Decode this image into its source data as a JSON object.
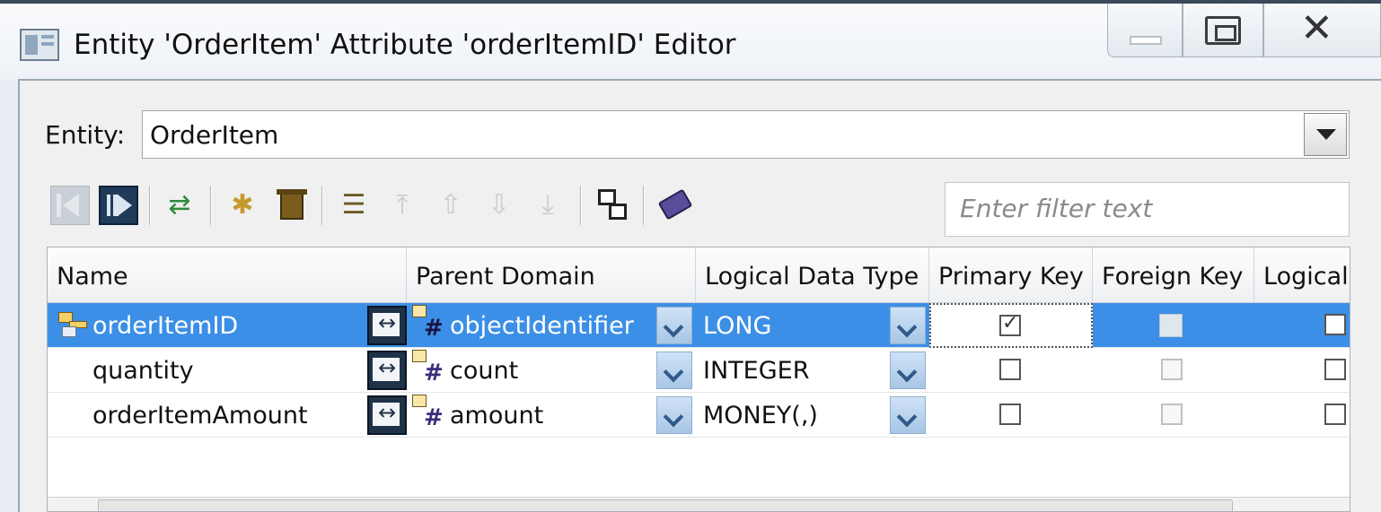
{
  "window": {
    "title": "Entity 'OrderItem' Attribute 'orderItemID' Editor"
  },
  "entity": {
    "label": "Entity:",
    "value": "OrderItem"
  },
  "filter": {
    "placeholder": "Enter filter text"
  },
  "toolbar": {
    "icons": [
      "first-icon",
      "last-icon",
      "generate-icon",
      "new-attribute-icon",
      "delete-icon",
      "properties-icon",
      "move-top-icon",
      "move-up-icon",
      "move-down-icon",
      "move-bottom-icon",
      "copy-icon",
      "tag-icon"
    ]
  },
  "grid": {
    "columns": [
      "Name",
      "Parent Domain",
      "Logical Data Type",
      "Primary Key",
      "Foreign Key",
      "Logical"
    ],
    "rows": [
      {
        "name": "orderItemID",
        "domain": "objectIdentifier",
        "type": "LONG",
        "primary_key": true,
        "foreign_key": false,
        "logical": false,
        "selected": true
      },
      {
        "name": "quantity",
        "domain": "count",
        "type": "INTEGER",
        "primary_key": false,
        "foreign_key": false,
        "logical": false,
        "selected": false
      },
      {
        "name": "orderItemAmount",
        "domain": "amount",
        "type": "MONEY(,)",
        "primary_key": false,
        "foreign_key": false,
        "logical": false,
        "selected": false
      }
    ],
    "domain_glyph": "#"
  },
  "colors": {
    "selection": "#3c8fe6",
    "window_bg": "#f0f0f0"
  }
}
